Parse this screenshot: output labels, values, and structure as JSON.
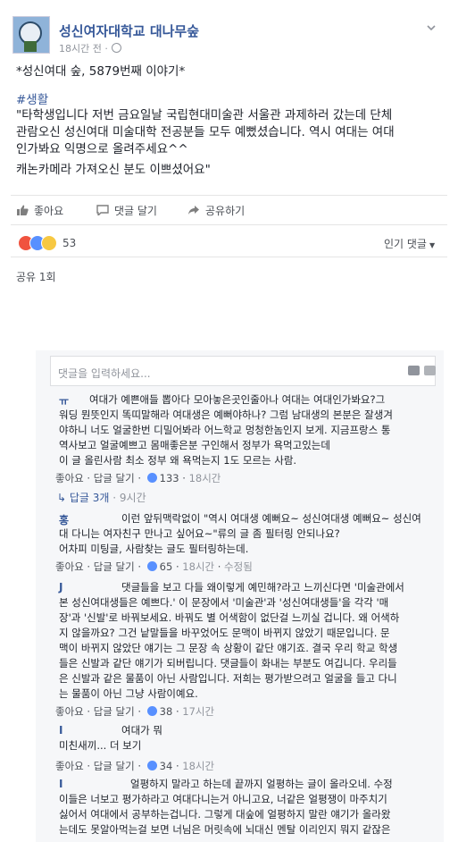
{
  "post": {
    "page_name": "성신여자대학교 대나무숲",
    "time": "18시간 전 ·",
    "title_line": "*성신여대 숲, 5879번째 이야기*",
    "hashtag": "#생활",
    "body_lines": [
      "\"타학생입니다 저번 금요일날 국립현대미술관 서울관 과제하러 갔는데 단체",
      "관람오신 성신여대 미술대학 전공분들 모두 예뻤셨습니다. 역시 여대는 여대",
      "인가봐요 익명으로 올려주세요^^",
      "캐논카메라 가져오신 분도 이쁘셨어요\""
    ],
    "actions": {
      "like": "좋아요",
      "comment": "댓글 달기",
      "share": "공유하기"
    },
    "reaction_count": "53",
    "popular_comments": "인기 댓글",
    "share_count": "공유 1회"
  },
  "comment_input": {
    "placeholder": "댓글을 입력하세요..."
  },
  "comments": [
    {
      "name": "ㅠ",
      "lines": [
        "여대가 예쁜애들 뽑아다 모아놓은곳인줄아나 여대는 여대인가봐요?그",
        "워딩 뭔뜻인지 똑띠말해라 여대생은 예뻐야하나? 그럼 남대생의 본분은 잘생겨",
        "야하니 너도 얼굴한번 디밀어봐라 어느학교 멍청한놈인지 보게. 지금프랑스 통",
        "역사보고 얼굴예쁘고 몸매좋은분 구인해서 정부가 욕먹고있는데",
        "이 글 올린사람 최소 정부 왜 욕먹는지 1도 모르는 사람."
      ],
      "like": "좋아요",
      "reply": "답글 달기",
      "likes": "133",
      "time": "18시간",
      "replies": "답글 3개",
      "replies_time": "9시간"
    },
    {
      "name": "홍",
      "lines": [
        "이런 앞뒤맥락없이 \"역시 여대생 예뻐요~ 성신여대생 예뻐요~ 성신여",
        "대 다니는 여자친구 만나고 싶어요~\"류의 글 좀 필터링 안되나요?",
        "어차피 미팅글, 사람찾는 글도 필터링하는데."
      ],
      "like": "좋아요",
      "reply": "답글 달기",
      "likes": "65",
      "time": "18시간",
      "edited": "수정됨"
    },
    {
      "name": "J",
      "lines": [
        "댓글들을 보고 다들 왜이렇게 예민해?라고 느끼신다면 '미술관에서",
        "본 성신여대생들은 예쁘다.' 이 문장에서 '미술관'과 '성신여대생들'을 각각 '매",
        "장'과 '신발'로 바꿔보세요. 바꿔도 별 어색함이 없단걸 느끼실 겁니다. 왜 어색하",
        "지 않을까요? 그건 낱말들을 바꾸었어도 문맥이 바뀌지 않았기 때문입니다. 문",
        "맥이 바뀌지 않았단 얘기는 그 문장 속 상황이 같단 얘기죠. 결국 우리 학교 학생",
        "들은 신발과 같단 얘기가 되버립니다. 댓글들이 화내는 부분도 여깁니다. 우리들",
        "은 신발과 같은 물품이 아닌 사람입니다. 저희는 평가받으려고 얼굴을 들고 다니",
        "는 물품이 아닌 그냥 사람이예요."
      ],
      "like": "좋아요",
      "reply": "답글 달기",
      "likes": "38",
      "time": "17시간"
    },
    {
      "name": "I",
      "lines": [
        "여대가 뭐",
        "미친새끼... 더 보기"
      ],
      "like": "좋아요",
      "reply": "답글 달기",
      "likes": "34",
      "time": "18시간"
    },
    {
      "name": "I",
      "lines": [
        "얼평하지 말라고 하는데 끝까지 얼평하는 글이 올라오네. 수정",
        "이들은 너보고 평가하라고 여대다니는거 아니고요, 너같은 얼평쟁이 마주치기",
        "싫어서 여대에서 공부하는겁니다. 그렇게 대숲에 얼평하지 말란 얘기가 올라왔",
        "는데도 못알아먹는걸 보면 너님은 머릿속에 뇌대신 멘탈 이리인지 뭐지 같잖은"
      ]
    }
  ]
}
